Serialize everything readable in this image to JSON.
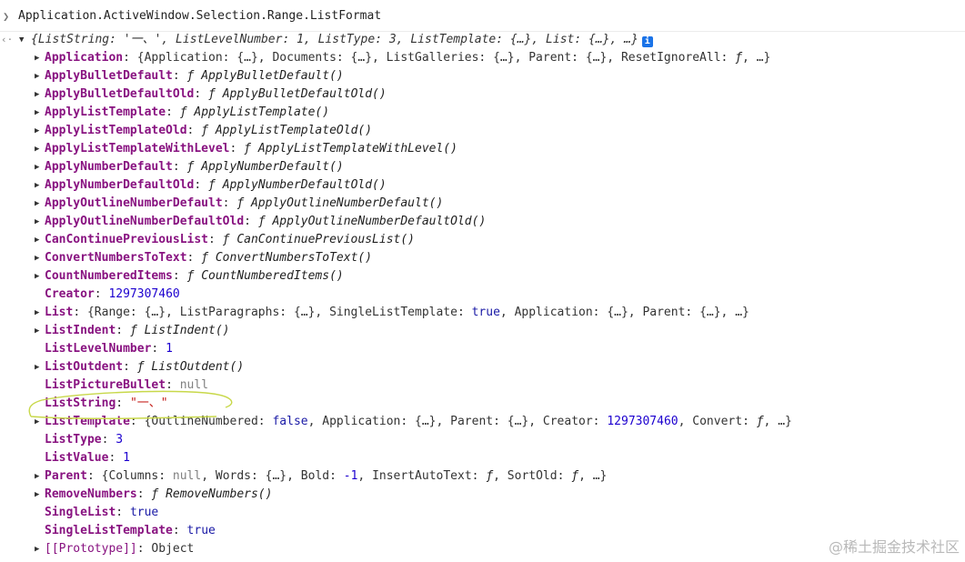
{
  "console": {
    "input": "Application.ActiveWindow.Selection.Range.ListFormat",
    "summary": "{ListString: '一、', ListLevelNumber: 1, ListType: 3, ListTemplate: {…}, List: {…}, …}",
    "info_icon": "i",
    "props": [
      {
        "key": "Application",
        "expand": true,
        "parts": [
          [
            "p",
            "{Application: {…}, Documents: {…}, ListGalleries: {…}, Parent: {…}, ResetIgnoreAll: "
          ],
          [
            "fsym",
            "ƒ"
          ],
          [
            "p",
            ", …}"
          ]
        ]
      },
      {
        "key": "ApplyBulletDefault",
        "expand": true,
        "parts": [
          [
            "fsym",
            "ƒ "
          ],
          [
            "fn",
            "ApplyBulletDefault()"
          ]
        ]
      },
      {
        "key": "ApplyBulletDefaultOld",
        "expand": true,
        "parts": [
          [
            "fsym",
            "ƒ "
          ],
          [
            "fn",
            "ApplyBulletDefaultOld()"
          ]
        ]
      },
      {
        "key": "ApplyListTemplate",
        "expand": true,
        "parts": [
          [
            "fsym",
            "ƒ "
          ],
          [
            "fn",
            "ApplyListTemplate()"
          ]
        ]
      },
      {
        "key": "ApplyListTemplateOld",
        "expand": true,
        "parts": [
          [
            "fsym",
            "ƒ "
          ],
          [
            "fn",
            "ApplyListTemplateOld()"
          ]
        ]
      },
      {
        "key": "ApplyListTemplateWithLevel",
        "expand": true,
        "parts": [
          [
            "fsym",
            "ƒ "
          ],
          [
            "fn",
            "ApplyListTemplateWithLevel()"
          ]
        ]
      },
      {
        "key": "ApplyNumberDefault",
        "expand": true,
        "parts": [
          [
            "fsym",
            "ƒ "
          ],
          [
            "fn",
            "ApplyNumberDefault()"
          ]
        ]
      },
      {
        "key": "ApplyNumberDefaultOld",
        "expand": true,
        "parts": [
          [
            "fsym",
            "ƒ "
          ],
          [
            "fn",
            "ApplyNumberDefaultOld()"
          ]
        ]
      },
      {
        "key": "ApplyOutlineNumberDefault",
        "expand": true,
        "parts": [
          [
            "fsym",
            "ƒ "
          ],
          [
            "fn",
            "ApplyOutlineNumberDefault()"
          ]
        ]
      },
      {
        "key": "ApplyOutlineNumberDefaultOld",
        "expand": true,
        "parts": [
          [
            "fsym",
            "ƒ "
          ],
          [
            "fn",
            "ApplyOutlineNumberDefaultOld()"
          ]
        ]
      },
      {
        "key": "CanContinuePreviousList",
        "expand": true,
        "parts": [
          [
            "fsym",
            "ƒ "
          ],
          [
            "fn",
            "CanContinuePreviousList()"
          ]
        ]
      },
      {
        "key": "ConvertNumbersToText",
        "expand": true,
        "parts": [
          [
            "fsym",
            "ƒ "
          ],
          [
            "fn",
            "ConvertNumbersToText()"
          ]
        ]
      },
      {
        "key": "CountNumberedItems",
        "expand": true,
        "parts": [
          [
            "fsym",
            "ƒ "
          ],
          [
            "fn",
            "CountNumberedItems()"
          ]
        ]
      },
      {
        "key": "Creator",
        "expand": false,
        "parts": [
          [
            "num",
            "1297307460"
          ]
        ]
      },
      {
        "key": "List",
        "expand": true,
        "parts": [
          [
            "p",
            "{Range: {…}, ListParagraphs: {…}, SingleListTemplate: "
          ],
          [
            "bool",
            "true"
          ],
          [
            "p",
            ", Application: {…}, Parent: {…}, …}"
          ]
        ]
      },
      {
        "key": "ListIndent",
        "expand": true,
        "parts": [
          [
            "fsym",
            "ƒ "
          ],
          [
            "fn",
            "ListIndent()"
          ]
        ]
      },
      {
        "key": "ListLevelNumber",
        "expand": false,
        "parts": [
          [
            "num",
            "1"
          ]
        ]
      },
      {
        "key": "ListOutdent",
        "expand": true,
        "parts": [
          [
            "fsym",
            "ƒ "
          ],
          [
            "fn",
            "ListOutdent()"
          ]
        ]
      },
      {
        "key": "ListPictureBullet",
        "expand": false,
        "parts": [
          [
            "nul",
            "null"
          ]
        ]
      },
      {
        "key": "ListString",
        "expand": false,
        "parts": [
          [
            "str",
            "\"一、\""
          ]
        ]
      },
      {
        "key": "ListTemplate",
        "expand": true,
        "parts": [
          [
            "p",
            "{OutlineNumbered: "
          ],
          [
            "bool",
            "false"
          ],
          [
            "p",
            ", Application: {…}, Parent: {…}, Creator: "
          ],
          [
            "num",
            "1297307460"
          ],
          [
            "p",
            ", Convert: "
          ],
          [
            "fsym",
            "ƒ"
          ],
          [
            "p",
            ", …}"
          ]
        ]
      },
      {
        "key": "ListType",
        "expand": false,
        "parts": [
          [
            "num",
            "3"
          ]
        ]
      },
      {
        "key": "ListValue",
        "expand": false,
        "parts": [
          [
            "num",
            "1"
          ]
        ]
      },
      {
        "key": "Parent",
        "expand": true,
        "parts": [
          [
            "p",
            "{Columns: "
          ],
          [
            "nul",
            "null"
          ],
          [
            "p",
            ", Words: {…}, Bold: "
          ],
          [
            "num",
            "-1"
          ],
          [
            "p",
            ", InsertAutoText: "
          ],
          [
            "fsym",
            "ƒ"
          ],
          [
            "p",
            ", SortOld: "
          ],
          [
            "fsym",
            "ƒ"
          ],
          [
            "p",
            ", …}"
          ]
        ]
      },
      {
        "key": "RemoveNumbers",
        "expand": true,
        "parts": [
          [
            "fsym",
            "ƒ "
          ],
          [
            "fn",
            "RemoveNumbers()"
          ]
        ]
      },
      {
        "key": "SingleList",
        "expand": false,
        "parts": [
          [
            "bool",
            "true"
          ]
        ]
      },
      {
        "key": "SingleListTemplate",
        "expand": false,
        "parts": [
          [
            "bool",
            "true"
          ]
        ]
      },
      {
        "key": "[[Prototype]]",
        "expand": true,
        "proto": true,
        "parts": [
          [
            "p",
            "Object"
          ]
        ]
      }
    ]
  },
  "watermark": "@稀土掘金技术社区"
}
